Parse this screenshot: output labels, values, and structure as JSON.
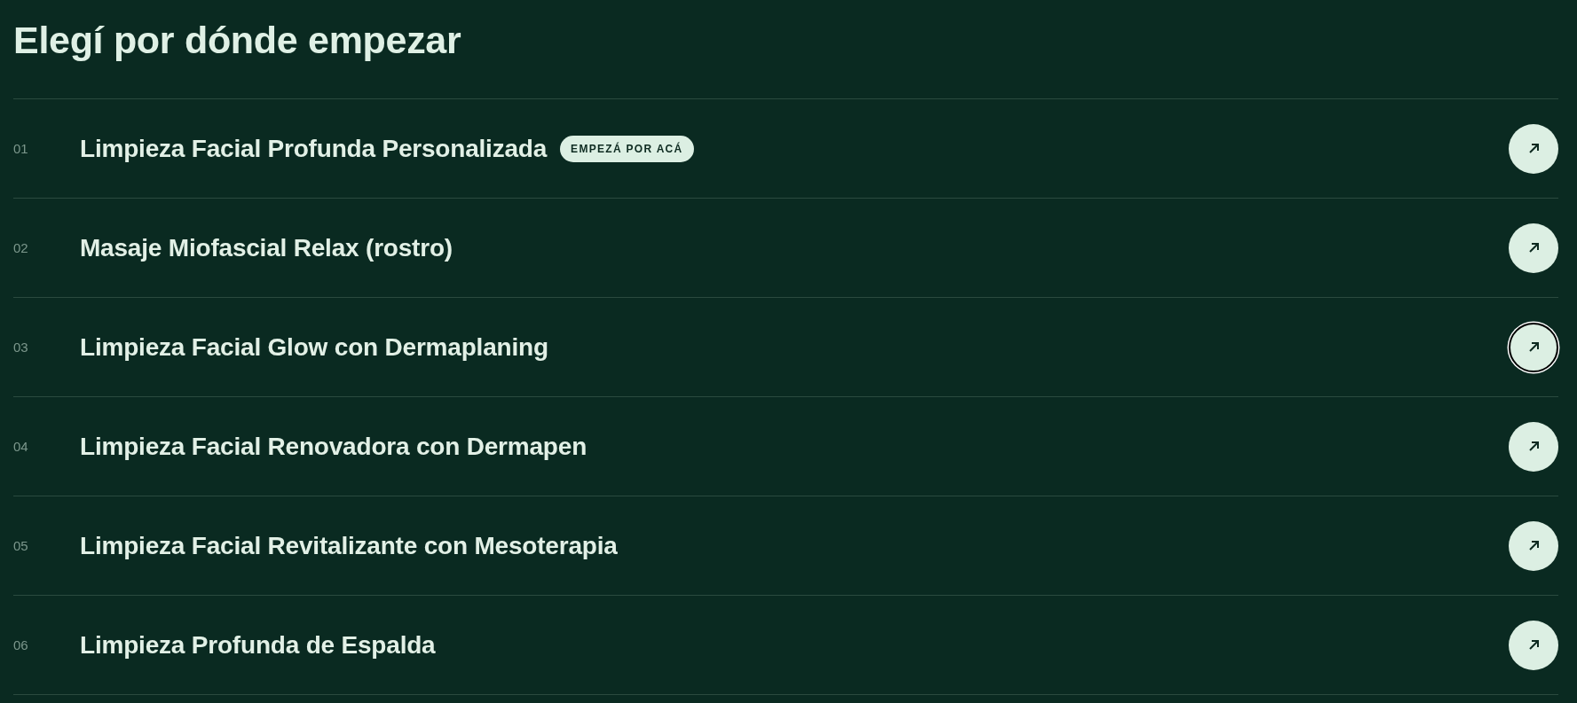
{
  "heading": "Elegí por dónde empezar",
  "items": [
    {
      "number": "01",
      "title": "Limpieza Facial Profunda Personalizada",
      "badge": "EMPEZÁ POR ACÁ",
      "focused": false
    },
    {
      "number": "02",
      "title": "Masaje Miofascial Relax (rostro)",
      "focused": false
    },
    {
      "number": "03",
      "title": "Limpieza Facial Glow con Dermaplaning",
      "focused": true
    },
    {
      "number": "04",
      "title": "Limpieza Facial Renovadora con Dermapen",
      "focused": false
    },
    {
      "number": "05",
      "title": "Limpieza Facial Revitalizante con Mesoterapia",
      "focused": false
    },
    {
      "number": "06",
      "title": "Limpieza Profunda de Espalda",
      "focused": false
    }
  ]
}
